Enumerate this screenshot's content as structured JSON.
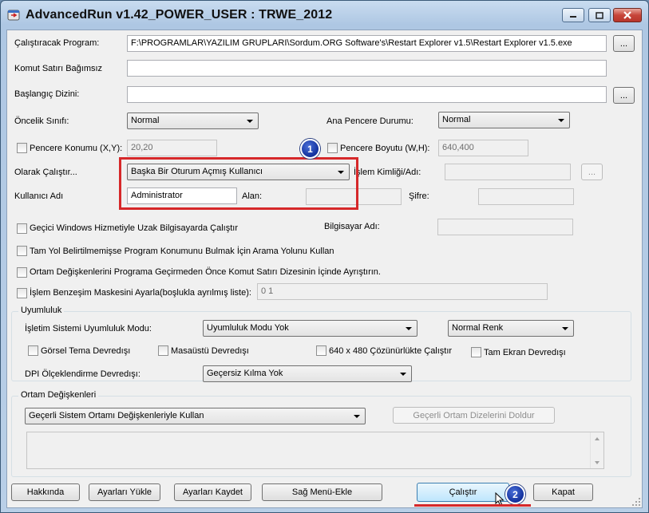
{
  "window": {
    "title": "AdvancedRun v1.42_POWER_USER : TRWE_2012"
  },
  "form": {
    "program_label": "Çalıştıracak Program:",
    "program_value": "F:\\PROGRAMLAR\\YAZILIM GRUPLARI\\Sordum.ORG Software's\\Restart Explorer v1.5\\Restart Explorer v1.5.exe",
    "browse_label": "...",
    "cmdline_label": "Komut Satırı Bağımsız",
    "cmdline_value": "",
    "startdir_label": "Başlangıç Dizini:",
    "startdir_value": "",
    "priority_label": "Öncelik Sınıfı:",
    "priority_value": "Normal",
    "mainwin_label": "Ana Pencere Durumu:",
    "mainwin_value": "Normal",
    "winpos_label": "Pencere Konumu (X,Y):",
    "winpos_value": "20,20",
    "winsize_label": "Pencere Boyutu (W,H):",
    "winsize_value": "640,400",
    "runas_label": "Olarak Çalıştır...",
    "runas_value": "Başka Bir Oturum Açmış Kullanıcı",
    "process_label": "İşlem Kimliği/Adı:",
    "process_value": "",
    "username_label": "Kullanıcı Adı",
    "username_value": "Administrator",
    "domain_label": "Alan:",
    "domain_value": "",
    "password_label": "Şifre:",
    "password_value": "",
    "remote_service_label": "Geçici Windows Hizmetiyle Uzak Bilgisayarda Çalıştır",
    "computer_label": "Bilgisayar Adı:",
    "computer_value": "",
    "search_path_label": "Tam Yol Belirtilmemişse Program Konumunu Bulmak İçin Arama Yolunu Kullan",
    "parse_env_label": "Ortam Değişkenlerini Programa Geçirmeden Önce Komut Satırı Dizesinin İçinde Ayrıştırın.",
    "affinity_label": "İşlem Benzeşim Maskesini Ayarla(boşlukla ayrılmış liste):",
    "affinity_value": "0 1"
  },
  "compat": {
    "group_title": "Uyumluluk",
    "os_mode_label": "İşletim Sistemi Uyumluluk Modu:",
    "os_mode_value": "Uyumluluk Modu Yok",
    "color_value": "Normal Renk",
    "visual_theme_label": "Görsel Tema Devredışı",
    "desktop_label": "Masaüstü  Devredışı",
    "res640_label": "640 x 480 Çözünürlükte Çalıştır",
    "fullscreen_label": "Tam Ekran Devredışı",
    "dpi_label": "DPI Ölçeklendirme Devredışı:",
    "dpi_value": "Geçersiz Kılma Yok"
  },
  "env": {
    "group_title": "Ortam Değişkenleri",
    "mode_value": "Geçerli Sistem Ortamı Değişkenleriyle Kullan",
    "fill_button": "Geçerli Ortam Dizelerini Doldur"
  },
  "buttons": {
    "about": "Hakkında",
    "load": "Ayarları Yükle",
    "save": "Ayarları Kaydet",
    "context_menu": "Sağ Menü-Ekle",
    "run": "Çalıştır",
    "close": "Kapat"
  },
  "annotations": {
    "badge1": "1",
    "badge2": "2",
    "highlight_color": "#d6282a",
    "badge_color": "#1a3aa8"
  }
}
